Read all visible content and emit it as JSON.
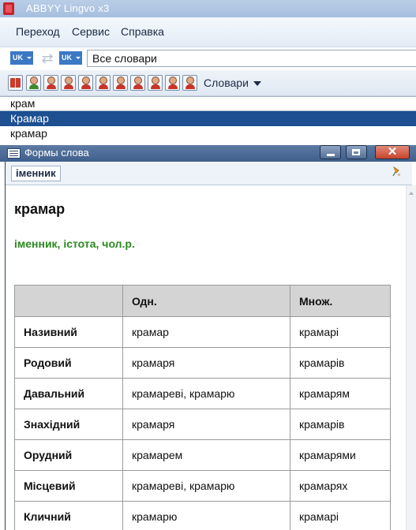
{
  "app": {
    "title": "ABBYY Lingvo x3"
  },
  "menu": {
    "items": [
      "Переход",
      "Сервис",
      "Справка"
    ]
  },
  "toolbar": {
    "source_lang": "UK",
    "target_lang": "UK",
    "dictionary_select": "Все словари",
    "dictionaries_label": "Словари"
  },
  "search": {
    "value": "крам"
  },
  "word_list": {
    "items": [
      "Крамар",
      "крамар"
    ]
  },
  "word_forms": {
    "window_title": "Формы слова",
    "pos_tab": "іменник",
    "heading": "крамар",
    "grammar": "іменник, істота, чол.р.",
    "columns": [
      "",
      "Одн.",
      "Множ."
    ],
    "rows": [
      {
        "case": "Називний",
        "singular": "крамар",
        "plural": "крамарі"
      },
      {
        "case": "Родовий",
        "singular": "крамаря",
        "plural": "крамарів"
      },
      {
        "case": "Давальний",
        "singular": "крамареві, крамарю",
        "plural": "крамарям"
      },
      {
        "case": "Знахідний",
        "singular": "крамаря",
        "plural": "крамарів"
      },
      {
        "case": "Орудний",
        "singular": "крамарем",
        "plural": "крамарями"
      },
      {
        "case": "Місцевий",
        "singular": "крамареві, крамарю",
        "plural": "крамарях"
      },
      {
        "case": "Кличний",
        "singular": "крамарю",
        "plural": "крамарі"
      }
    ]
  }
}
